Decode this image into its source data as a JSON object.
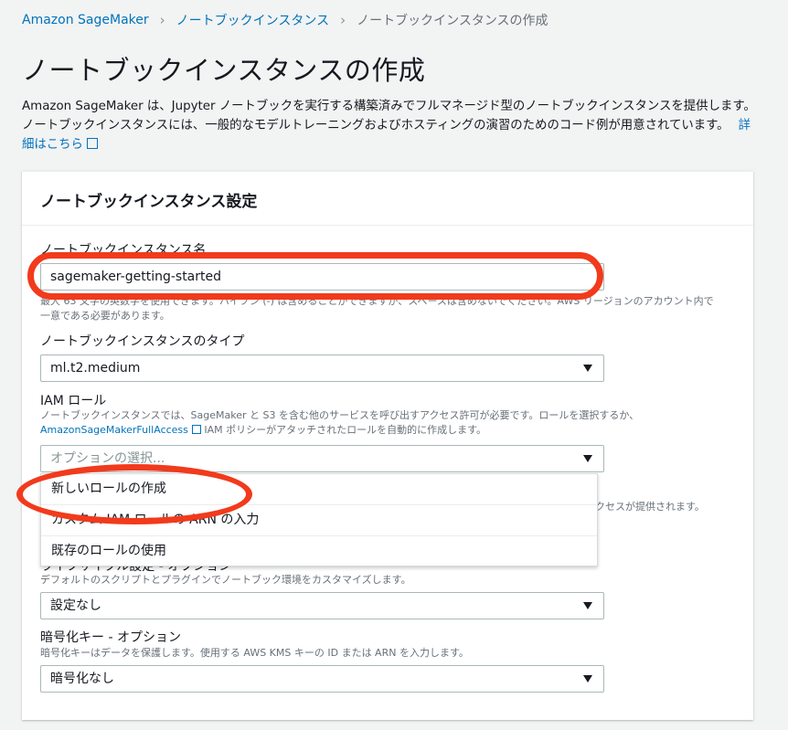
{
  "breadcrumb": {
    "items": [
      "Amazon SageMaker",
      "ノートブックインスタンス",
      "ノートブックインスタンスの作成"
    ]
  },
  "page": {
    "title": "ノートブックインスタンスの作成",
    "description": "Amazon SageMaker は、Jupyter ノートブックを実行する構築済みでフルマネージド型のノートブックインスタンスを提供します。ノートブックインスタンスには、一般的なモデルトレーニングおよびホスティングの演習のためのコード例が用意されています。",
    "learn_more": "詳細はこちら"
  },
  "panel": {
    "title": "ノートブックインスタンス設定",
    "name": {
      "label": "ノートブックインスタンス名",
      "value": "sagemaker-getting-started",
      "help": "最大 63 文字の英数字を使用できます。ハイフン (-) は含めることができますが、スペースは含めないでください。AWS リージョンのアカウント内で一意である必要があります。"
    },
    "type": {
      "label": "ノートブックインスタンスのタイプ",
      "value": "ml.t2.medium"
    },
    "iam": {
      "label": "IAM ロール",
      "help_prefix": "ノートブックインスタンスでは、SageMaker と S3 を含む他のサービスを呼び出すアクセス許可が必要です。ロールを選択するか、",
      "help_link": "AmazonSageMakerFullAccess",
      "help_suffix": "IAM ポリシーがアタッチされたロールを自動的に作成します。",
      "placeholder": "オプションの選択...",
      "options": [
        "新しいロールの作成",
        "カスタム IAM ロールの ARN の入力",
        "既存のロールの使用"
      ],
      "obscured_help_tail": "クセスが提供されます。"
    },
    "lifecycle": {
      "label": "ライフサイクル設定 - オプション",
      "help": "デフォルトのスクリプトとプラグインでノートブック環境をカスタマイズします。",
      "value": "設定なし"
    },
    "encryption": {
      "label": "暗号化キー - オプション",
      "help": "暗号化キーはデータを保護します。使用する AWS KMS キーの ID または ARN を入力します。",
      "value": "暗号化なし"
    }
  },
  "colors": {
    "link": "#0073bb",
    "annotation": "#f23a1c",
    "background": "#f2f3f3"
  }
}
